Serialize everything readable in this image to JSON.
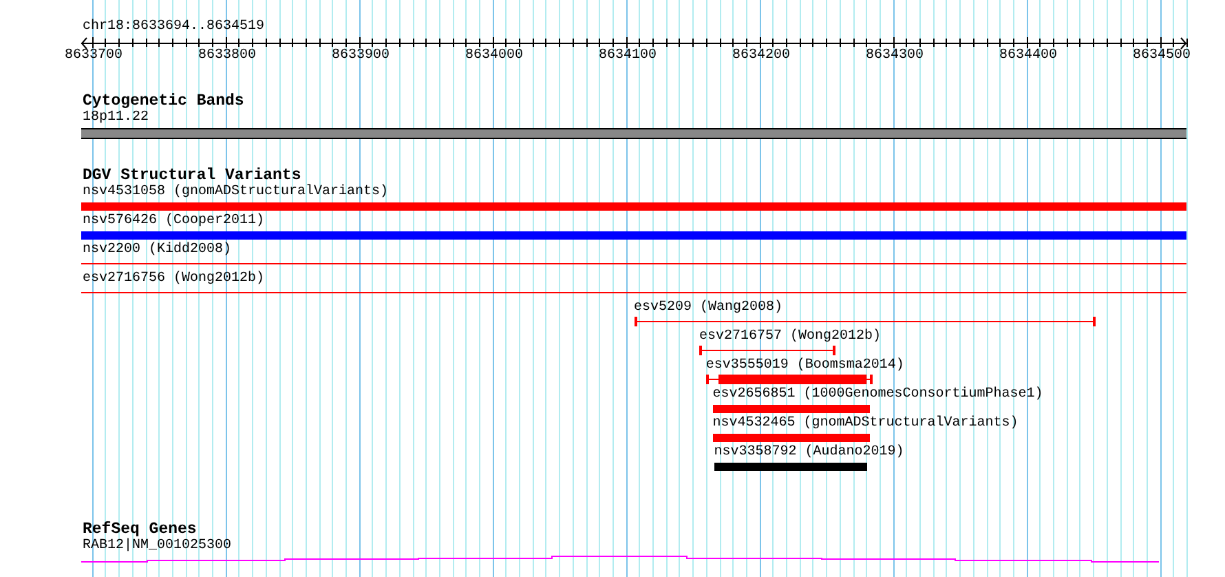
{
  "location": "chr18:8633694..8634519",
  "ruler": {
    "ticks": [
      "8633700",
      "8633800",
      "8633900",
      "8634000",
      "8634100",
      "8634200",
      "8634300",
      "8634400",
      "8634500"
    ]
  },
  "tracks": [
    {
      "kind": "bands",
      "title": "Cytogenetic Bands",
      "label": "18p11.22"
    },
    {
      "kind": "variants",
      "title": "DGV Structural Variants",
      "features": [
        {
          "label": "nsv4531058 (gnomADStructuralVariants)",
          "kind": "bar",
          "color": "#ff0000"
        },
        {
          "label": "nsv576426 (Cooper2011)",
          "kind": "bar",
          "color": "#0000ff"
        },
        {
          "label": "nsv2200 (Kidd2008)",
          "kind": "line",
          "color": "#ff0000"
        },
        {
          "label": "esv2716756 (Wong2012b)",
          "kind": "line",
          "color": "#ff0000"
        },
        {
          "label": "esv5209 (Wang2008)",
          "kind": "interval",
          "color": "#ff0000"
        },
        {
          "label": "esv2716757 (Wong2012b)",
          "kind": "interval",
          "color": "#ff0000"
        },
        {
          "label": "esv3555019 (Boomsma2014)",
          "kind": "flanked",
          "color": "#ff0000"
        },
        {
          "label": "esv2656851 (1000GenomesConsortiumPhase1)",
          "kind": "bar",
          "color": "#ff0000"
        },
        {
          "label": "nsv4532465 (gnomADStructuralVariants)",
          "kind": "bar",
          "color": "#ff0000"
        },
        {
          "label": "nsv3358792 (Audano2019)",
          "kind": "bar",
          "color": "#000000"
        }
      ]
    },
    {
      "kind": "genes",
      "title": "RefSeq Genes",
      "label": "RAB12|NM_001025300"
    }
  ]
}
